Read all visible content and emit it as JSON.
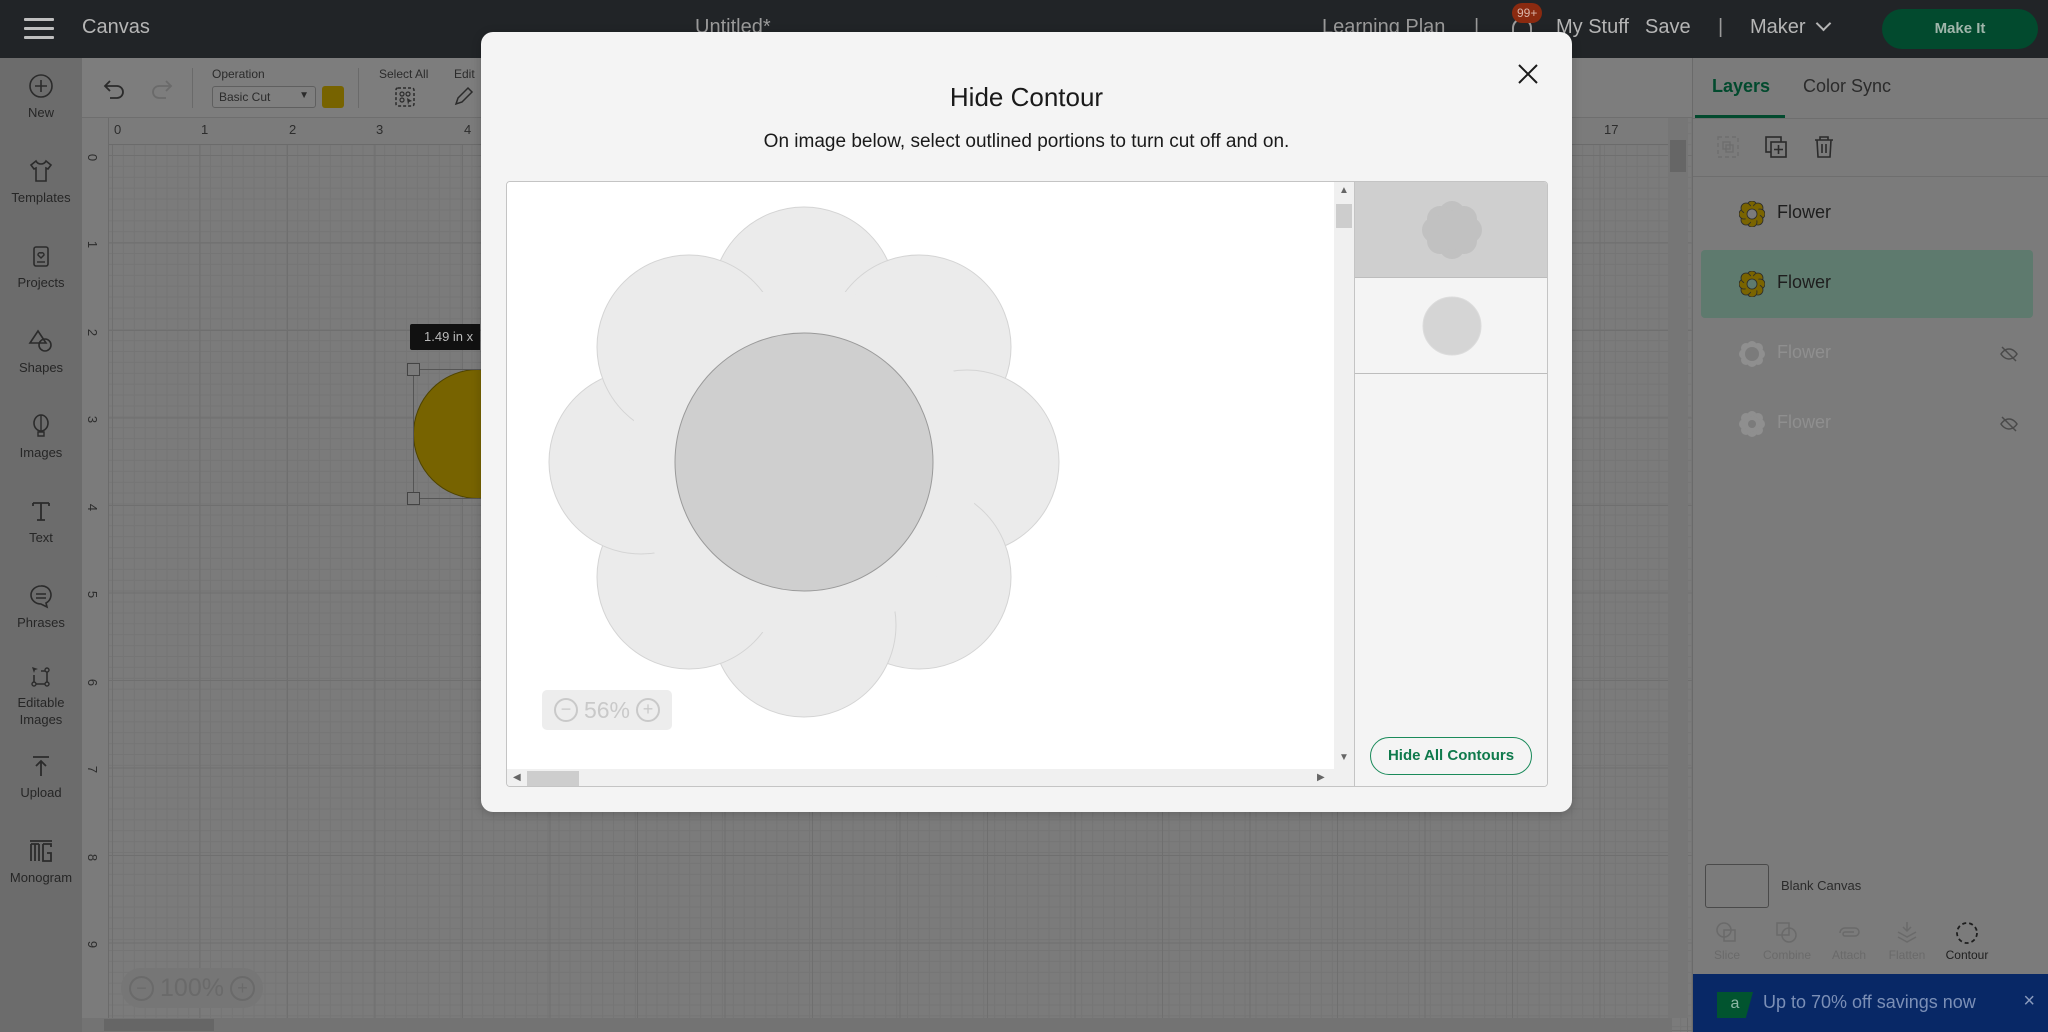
{
  "topbar": {
    "app_title": "Canvas",
    "document_title": "Untitled*",
    "learning_plan": "Learning Plan",
    "separator": "|",
    "notification_badge": "99+",
    "my_stuff": "My Stuff",
    "save": "Save",
    "machine": "Maker",
    "make_it": "Make It"
  },
  "sidebar": {
    "items": [
      {
        "label": "New",
        "icon": "plus-circle-icon"
      },
      {
        "label": "Templates",
        "icon": "shirt-icon"
      },
      {
        "label": "Projects",
        "icon": "card-heart-icon"
      },
      {
        "label": "Shapes",
        "icon": "shapes-icon"
      },
      {
        "label": "Images",
        "icon": "balloon-icon"
      },
      {
        "label": "Text",
        "icon": "text-icon"
      },
      {
        "label": "Phrases",
        "icon": "speech-bubble-icon"
      },
      {
        "label": "Editable Images",
        "icon": "editable-image-icon"
      },
      {
        "label": "Upload",
        "icon": "upload-icon"
      },
      {
        "label": "Monogram",
        "icon": "monogram-icon"
      }
    ]
  },
  "toolbar": {
    "operation_label": "Operation",
    "operation_value": "Basic Cut",
    "operation_color": "#776300",
    "select_all_label": "Select All",
    "edit_label": "Edit"
  },
  "canvas": {
    "ruler_top": [
      "0",
      "1",
      "2",
      "3",
      "4",
      "17"
    ],
    "ruler_left": [
      "0",
      "1",
      "2",
      "3",
      "4",
      "5",
      "6",
      "7",
      "8",
      "9"
    ],
    "dimension_tooltip": "1.49  in x",
    "zoom_level": "100%"
  },
  "modal": {
    "title": "Hide Contour",
    "subtitle": "On image below, select outlined portions to turn cut off and on.",
    "preview_zoom": "56%",
    "contours": [
      {
        "shape": "flower",
        "selected": true
      },
      {
        "shape": "circle",
        "selected": false
      }
    ],
    "hide_all_button": "Hide All Contours"
  },
  "right_panel": {
    "tabs": [
      {
        "label": "Layers",
        "active": true
      },
      {
        "label": "Color Sync",
        "active": false
      }
    ],
    "layers": [
      {
        "name": "Flower",
        "color": "#7a6400",
        "selected": false,
        "hidden": false
      },
      {
        "name": "Flower",
        "color": "#7a6400",
        "selected": true,
        "hidden": false
      },
      {
        "name": "Flower",
        "color": "#8f8f8f",
        "selected": false,
        "hidden": true
      },
      {
        "name": "Flower",
        "color": "#8f8f8f",
        "selected": false,
        "hidden": true
      }
    ],
    "blank_canvas": "Blank Canvas",
    "tools": [
      {
        "label": "Slice",
        "enabled": false
      },
      {
        "label": "Combine",
        "enabled": false
      },
      {
        "label": "Attach",
        "enabled": false
      },
      {
        "label": "Flatten",
        "enabled": false
      },
      {
        "label": "Contour",
        "enabled": true
      }
    ],
    "promo": {
      "logo": "a",
      "text": "Up to 70% off savings now",
      "close": "×"
    }
  },
  "colors": {
    "brand_green": "#024a2e",
    "accent_green": "#0f7a4c",
    "promo_blue": "#082866"
  }
}
